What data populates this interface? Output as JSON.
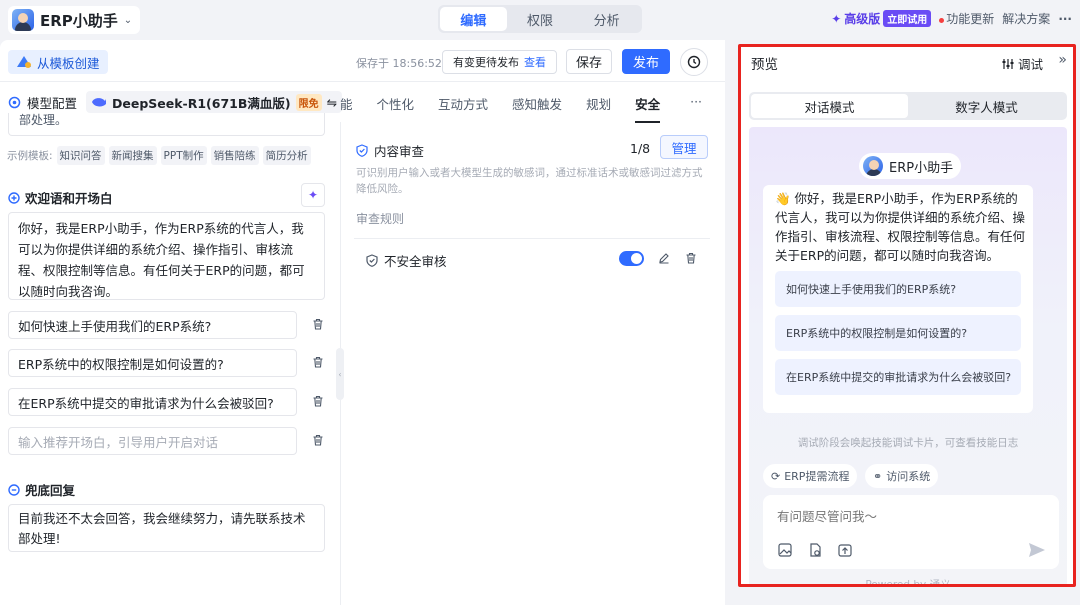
{
  "app": {
    "name": "ERP小助手"
  },
  "tabs": {
    "edit": "编辑",
    "permission": "权限",
    "analysis": "分析"
  },
  "topright": {
    "pro": "高级版",
    "trial": "立即试用",
    "updates": "功能更新",
    "solutions": "解决方案",
    "more": "···"
  },
  "toolbar": {
    "template": "从模板创建",
    "saved": "保存于 18:56:52",
    "pending": "有变更待发布",
    "view": "查看",
    "save": "保存",
    "publish": "发布"
  },
  "model": {
    "label": "模型配置",
    "name": "DeepSeek-R1(671B满血版)",
    "badge": "限免",
    "arrow": "⇋"
  },
  "midtabs": [
    "能",
    "个性化",
    "互动方式",
    "感知触发",
    "规划",
    "安全",
    "···"
  ],
  "left": {
    "cut_text": "部处理。",
    "examples_label": "示例模板:",
    "examples": [
      "知识问答",
      "新闻搜集",
      "PPT制作",
      "销售陪练",
      "简历分析"
    ],
    "welcome_title": "欢迎语和开场白",
    "welcome_text": "你好，我是ERP小助手，作为ERP系统的代言人，我可以为你提供详细的系统介绍、操作指引、审核流程、权限控制等信息。有任何关于ERP的问题，都可以随时向我咨询。",
    "questions": [
      "如何快速上手使用我们的ERP系统?",
      "ERP系统中的权限控制是如何设置的?",
      "在ERP系统中提交的审批请求为什么会被驳回?"
    ],
    "question_placeholder": "输入推荐开场白，引导用户开启对话",
    "fallback_title": "兜底回复",
    "fallback_text": "目前我还不太会回答，我会继续努力，请先联系技术部处理!"
  },
  "review": {
    "title": "内容审查",
    "count": "1/8",
    "manage": "管理",
    "desc": "可识别用户输入或者大模型生成的敏感词，通过标准话术或敏感词过滤方式降低风险。",
    "rules_label": "审查规则",
    "rule": "不安全审核",
    "rule_enabled": true
  },
  "preview": {
    "title": "预览",
    "debug": "调试",
    "modes": [
      "对话模式",
      "数字人模式"
    ],
    "bot": "ERP小助手",
    "message": "👋 你好，我是ERP小助手，作为ERP系统的代言人，我可以为你提供详细的系统介绍、操作指引、审核流程、权限控制等信息。有任何关于ERP的问题，都可以随时向我咨询。",
    "suggestions": [
      "如何快速上手使用我们的ERP系统?",
      "ERP系统中的权限控制是如何设置的?",
      "在ERP系统中提交的审批请求为什么会被驳回?"
    ],
    "hint": "调试阶段会唤起技能调试卡片，可查看技能日志",
    "skills": [
      "ERP提需流程",
      "访问系统"
    ],
    "input_placeholder": "有问题尽管问我～",
    "powered": "Powered by 通义"
  },
  "colors": {
    "accent": "#2f6bff",
    "highlight_border": "#e8231f",
    "pro": "#5a3ee8"
  }
}
